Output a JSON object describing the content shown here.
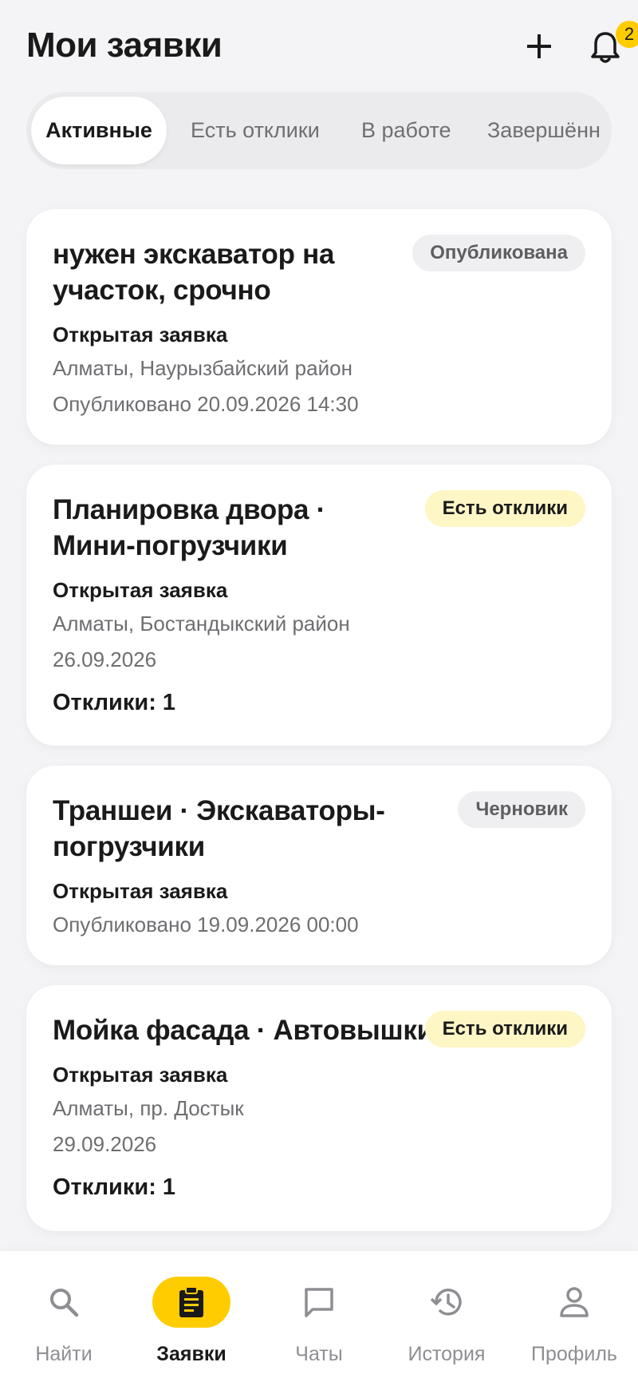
{
  "header": {
    "title": "Мои заявки",
    "notification_count": "2"
  },
  "tabs": [
    {
      "label": "Активные",
      "active": true
    },
    {
      "label": "Есть отклики",
      "active": false
    },
    {
      "label": "В работе",
      "active": false
    },
    {
      "label": "Завершённ",
      "active": false
    }
  ],
  "requests": [
    {
      "title": "нужен экскаватор на участок, срочно",
      "status": "Опубликована",
      "type": "Открытая заявка",
      "location": "Алматы, Наурызбайский район",
      "date": "Опубликовано 20.09.2026 14:30"
    },
    {
      "title": "Планировка двора · Мини-погрузчики",
      "status": "Есть отклики",
      "type": "Открытая заявка",
      "location": "Алматы, Бостандыкский район",
      "date": "26.09.2026",
      "responses": "Отклики: 1"
    },
    {
      "title": "Траншеи · Экскаваторы-погрузчики",
      "status": "Черновик",
      "type": "Открытая заявка",
      "date": "Опубликовано 19.09.2026 00:00"
    },
    {
      "title": "Мойка фасада · Автовышки",
      "status": "Есть отклики",
      "type": "Открытая заявка",
      "location": "Алматы, пр. Достык",
      "date": "29.09.2026",
      "responses": "Отклики: 1"
    }
  ],
  "status_colors": {
    "published": "#efeff1",
    "has_responses": "#fff6c6",
    "draft": "#efeff1"
  },
  "accent_color": "#ffcc00",
  "bottom_nav": [
    {
      "label": "Найти",
      "icon": "search-icon",
      "active": false
    },
    {
      "label": "Заявки",
      "icon": "clipboard-icon",
      "active": true
    },
    {
      "label": "Чаты",
      "icon": "chat-icon",
      "active": false
    },
    {
      "label": "История",
      "icon": "history-icon",
      "active": false
    },
    {
      "label": "Профиль",
      "icon": "profile-icon",
      "active": false
    }
  ]
}
